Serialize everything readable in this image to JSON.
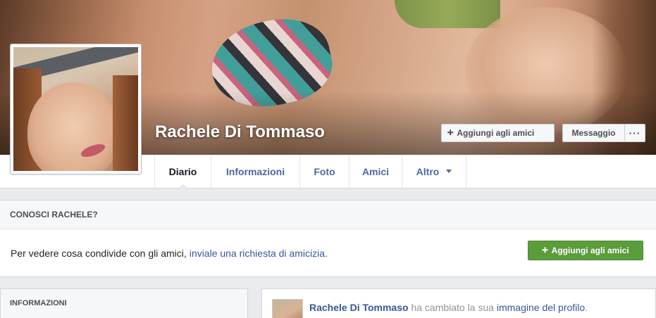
{
  "profile": {
    "name": "Rachele Di Tommaso"
  },
  "actions": {
    "add_friend_label": "Aggiungi agli amici",
    "message_label": "Messaggio",
    "more_label": "···"
  },
  "nav": {
    "tabs": [
      {
        "label": "Diario"
      },
      {
        "label": "Informazioni"
      },
      {
        "label": "Foto"
      },
      {
        "label": "Amici"
      },
      {
        "label": "Altro"
      }
    ]
  },
  "conosci": {
    "title": "CONOSCI RACHELE?",
    "text": "Per vedere cosa condivide con gli amici,",
    "link": "inviale una richiesta di amicizia.",
    "button_label": "Aggiungi agli amici"
  },
  "info_card": {
    "title": "INFORMAZIONI"
  },
  "post": {
    "author": "Rachele Di Tommaso",
    "action_text": "ha cambiato la sua",
    "link": "immagine del profilo",
    "suffix": "."
  },
  "colors": {
    "link": "#365899",
    "green_button": "#5b9c3b",
    "background": "#e9ebee"
  }
}
